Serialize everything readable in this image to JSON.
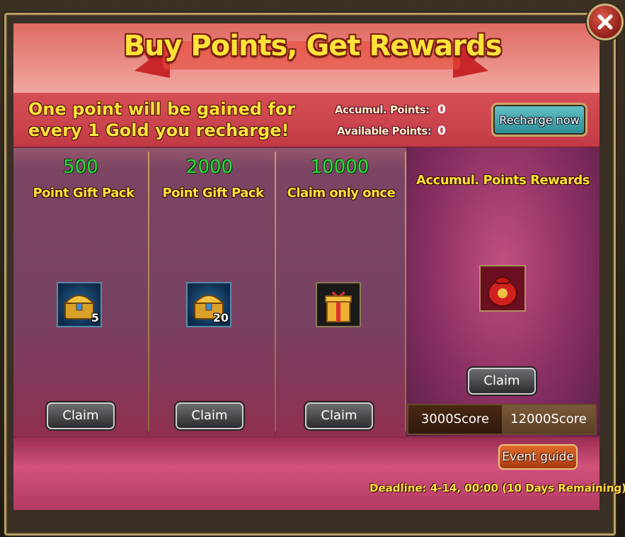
{
  "dialog": {
    "title": "Buy Points, Get Rewards",
    "info_text": "One point will be gained for every 1 Gold you recharge!",
    "accumul_points_label": "Accumul. Points:",
    "accumul_points_value": "0",
    "available_points_label": "Available Points:",
    "available_points_value": "0",
    "recharge_label": "Recharge now"
  },
  "packs": [
    {
      "points": "500",
      "name": "Point Gift Pack",
      "icon": "treasure-chest-icon",
      "count": "5",
      "claim_label": "Claim"
    },
    {
      "points": "2000",
      "name": "Point Gift Pack",
      "icon": "treasure-chest-icon",
      "count": "20",
      "claim_label": "Claim"
    },
    {
      "points": "10000",
      "name": "Claim only once",
      "icon": "gift-box-icon",
      "count": "",
      "claim_label": "Claim"
    }
  ],
  "rewards": {
    "title": "Accumul. Points Rewards",
    "icon": "lucky-bag-icon",
    "claim_label": "Claim",
    "tabs": [
      "3000Score",
      "12000Score"
    ],
    "active_tab": "3000Score"
  },
  "event_guide_label": "Event guide",
  "deadline": "Deadline: 4-14, 00:00 (10 Days Remaining)",
  "colors": {
    "title": "#ffe23a",
    "points_green": "#28e03a",
    "accent_red": "#c23a45"
  }
}
